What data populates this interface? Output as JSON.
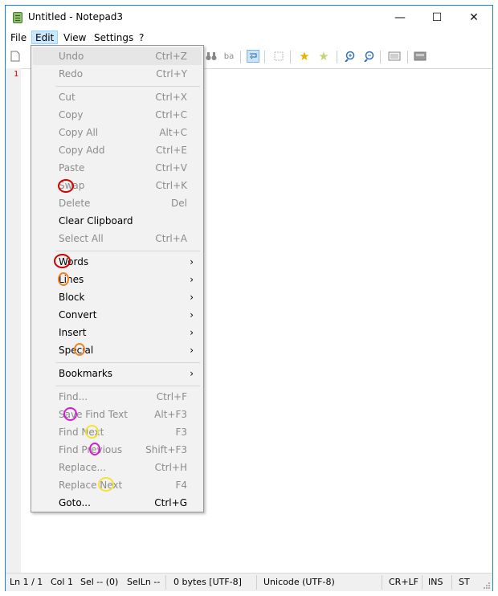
{
  "window": {
    "title": "Untitled - Notepad3"
  },
  "titlebar_buttons": {
    "minimize": "—",
    "maximize": "☐",
    "close": "✕"
  },
  "menubar": [
    "File",
    "Edit",
    "View",
    "Settings",
    "?"
  ],
  "editor": {
    "first_line_number": "1"
  },
  "edit_menu": {
    "items": [
      {
        "label": "Undo",
        "shortcut": "Ctrl+Z",
        "enabled": false
      },
      {
        "label": "Redo",
        "shortcut": "Ctrl+Y",
        "enabled": false
      },
      {
        "label": "Cut",
        "shortcut": "Ctrl+X",
        "enabled": false
      },
      {
        "label": "Copy",
        "shortcut": "Ctrl+C",
        "enabled": false
      },
      {
        "label": "Copy All",
        "shortcut": "Alt+C",
        "enabled": false
      },
      {
        "label": "Copy Add",
        "shortcut": "Ctrl+E",
        "enabled": false
      },
      {
        "label": "Paste",
        "shortcut": "Ctrl+V",
        "enabled": false
      },
      {
        "label": "Swap",
        "shortcut": "Ctrl+K",
        "enabled": false
      },
      {
        "label": "Delete",
        "shortcut": "Del",
        "enabled": false
      },
      {
        "label": "Clear Clipboard",
        "shortcut": "",
        "enabled": true
      },
      {
        "label": "Select All",
        "shortcut": "Ctrl+A",
        "enabled": false
      },
      {
        "label": "Words",
        "shortcut": "",
        "enabled": true,
        "submenu": true
      },
      {
        "label": "Lines",
        "shortcut": "",
        "enabled": true,
        "submenu": true
      },
      {
        "label": "Block",
        "shortcut": "",
        "enabled": true,
        "submenu": true
      },
      {
        "label": "Convert",
        "shortcut": "",
        "enabled": true,
        "submenu": true
      },
      {
        "label": "Insert",
        "shortcut": "",
        "enabled": true,
        "submenu": true
      },
      {
        "label": "Special",
        "shortcut": "",
        "enabled": true,
        "submenu": true
      },
      {
        "label": "Bookmarks",
        "shortcut": "",
        "enabled": true,
        "submenu": true
      },
      {
        "label": "Find...",
        "shortcut": "Ctrl+F",
        "enabled": false
      },
      {
        "label": "Save Find Text",
        "shortcut": "Alt+F3",
        "enabled": false
      },
      {
        "label": "Find Next",
        "shortcut": "F3",
        "enabled": false
      },
      {
        "label": "Find Previous",
        "shortcut": "Shift+F3",
        "enabled": false
      },
      {
        "label": "Replace...",
        "shortcut": "Ctrl+H",
        "enabled": false
      },
      {
        "label": "Replace Next",
        "shortcut": "F4",
        "enabled": false
      },
      {
        "label": "Goto...",
        "shortcut": "Ctrl+G",
        "enabled": true
      }
    ],
    "submenu_arrow": "›"
  },
  "statusbar": {
    "position": "Ln 1 / 1",
    "column": "Col 1",
    "selection": "Sel -- (0)",
    "sel_lines": "SelLn --",
    "size": "0 bytes [UTF-8]",
    "encoding": "Unicode (UTF-8)",
    "eol": "CR+LF",
    "ins": "INS",
    "mode": "ST"
  },
  "annotation_colors": {
    "red": "#d10000",
    "orange": "#e8832a",
    "magenta": "#d21ed2",
    "yellow": "#f2e23a"
  }
}
